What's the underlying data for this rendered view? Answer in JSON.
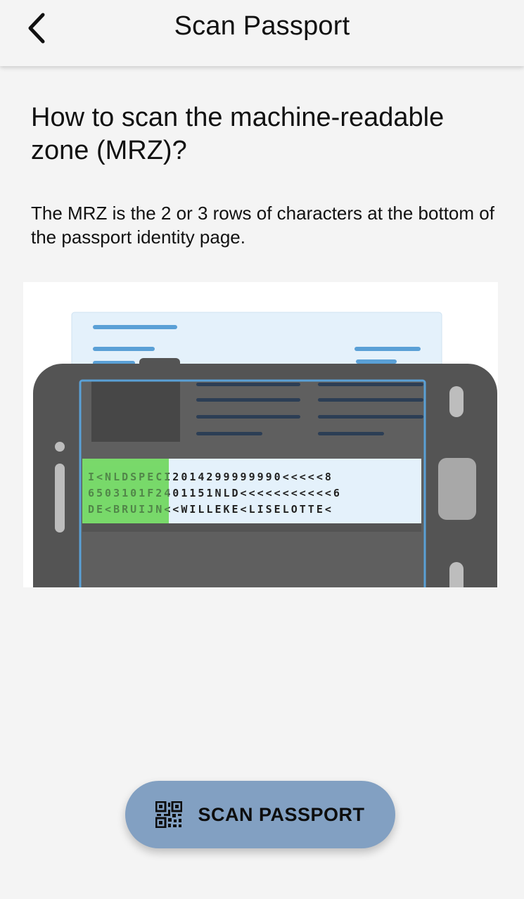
{
  "header": {
    "title": "Scan Passport",
    "back_icon": "chevron-left-icon"
  },
  "content": {
    "question": "How to scan the machine-readable zone (MRZ)?",
    "description": "The MRZ is the 2 or 3 rows of characters at the bottom of the passport identity page."
  },
  "illustration": {
    "mrz_lines": [
      "I<NLDSPECI2014299999990<<<<<8",
      "6503101F2401151NLD<<<<<<<<<<<6",
      "DE<BRUIJN<<WILLEKE<LISELOTTE<"
    ],
    "highlight_color": "#79d96a",
    "frame_color": "#5aa0d6"
  },
  "scan_button": {
    "label": "SCAN PASSPORT",
    "icon": "qr-code-icon"
  }
}
